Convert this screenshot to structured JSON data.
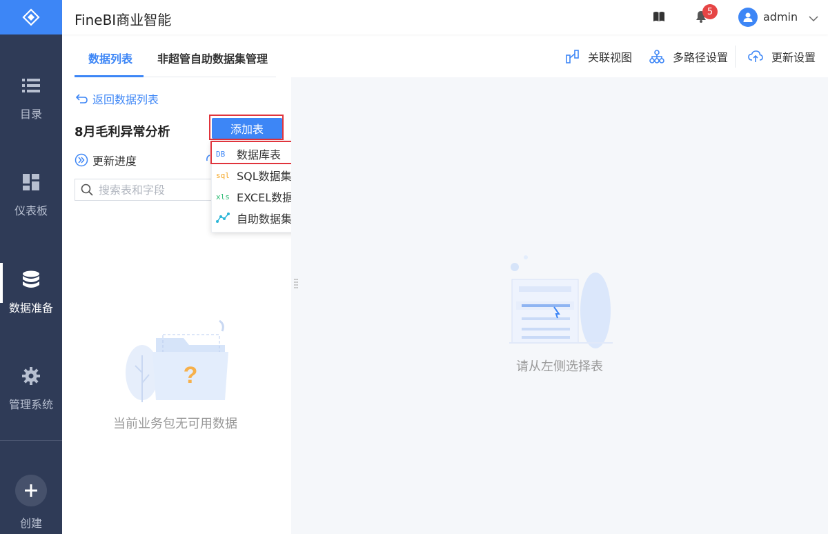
{
  "app": {
    "title": "FineBI商业智能"
  },
  "sidebar": {
    "items": [
      {
        "label": "目录",
        "icon": "list-icon"
      },
      {
        "label": "仪表板",
        "icon": "dashboard-icon"
      },
      {
        "label": "数据准备",
        "icon": "database-icon",
        "active": true
      },
      {
        "label": "管理系统",
        "icon": "gear-icon"
      }
    ],
    "create_label": "创建"
  },
  "header": {
    "notification_count": "5",
    "user_name": "admin"
  },
  "tabs": [
    {
      "label": "数据列表",
      "active": true
    },
    {
      "label": "非超管自助数据集管理",
      "active": false
    }
  ],
  "toolbar": {
    "relation_view": "关联视图",
    "multipath": "多路径设置",
    "update_settings": "更新设置"
  },
  "left_panel": {
    "back_link": "返回数据列表",
    "package_title": "8月毛利异常分析",
    "add_table_button": "添加表",
    "update_progress": "更新进度",
    "search_placeholder": "搜索表和字段",
    "empty_text": "当前业务包无可用数据"
  },
  "add_table_menu": [
    {
      "label": "数据库表",
      "icon_text": "DB",
      "color": "#3d86f6"
    },
    {
      "label": "SQL数据集",
      "icon_text": "sql",
      "color": "#f5a623"
    },
    {
      "label": "EXCEL数据集",
      "icon_text": "xls",
      "color": "#2dbb73"
    },
    {
      "label": "自助数据集",
      "icon_text": "",
      "color": "#2bb6d8"
    }
  ],
  "right_panel": {
    "empty_text": "请从左侧选择表"
  },
  "colors": {
    "primary": "#3d86f6",
    "sidebar": "#2f3b57",
    "highlight": "#e0343c"
  }
}
